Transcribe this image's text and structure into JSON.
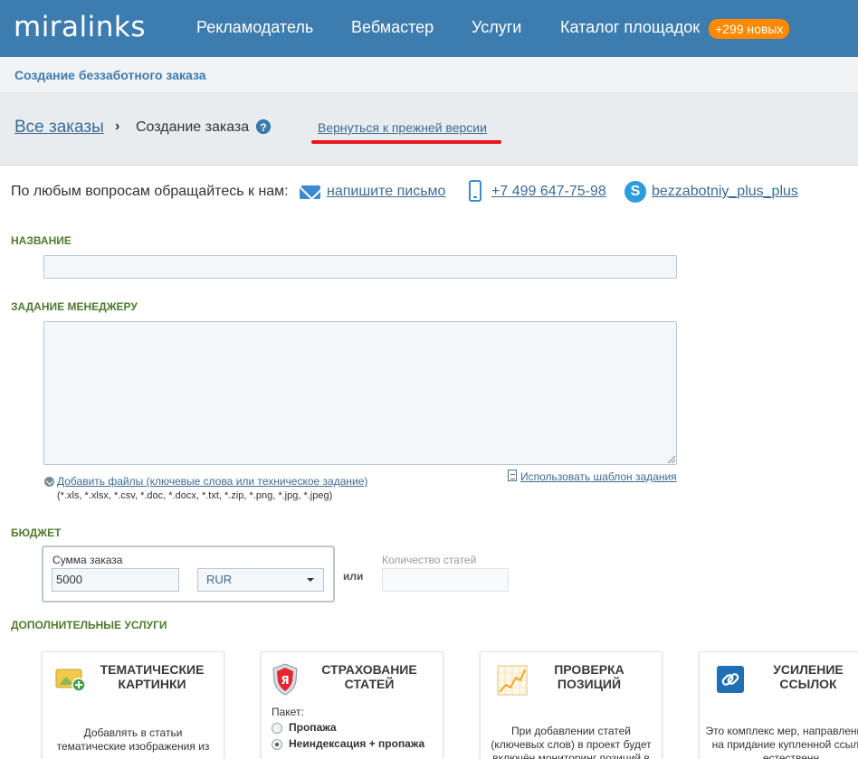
{
  "header": {
    "logo": "miralinks",
    "nav": [
      "Рекламодатель",
      "Вебмастер",
      "Услуги",
      "Каталог площадок"
    ],
    "badge": "+299 новых"
  },
  "subheader": {
    "title": "Создание беззаботного заказа"
  },
  "breadcrumb": {
    "all_orders": "Все заказы",
    "separator": "›",
    "current": "Создание заказа",
    "help": "?",
    "back_link": "Вернуться к прежней версии"
  },
  "contacts": {
    "text": "По любым вопросам обращайтесь к нам:",
    "email_link": "напишите письмо",
    "phone": "+7 499 647-75-98",
    "skype": "bezzabotniy_plus_plus"
  },
  "form": {
    "name_label": "НАЗВАНИЕ",
    "task_label": "ЗАДАНИЕ МЕНЕДЖЕРУ",
    "attach_link": "Добавить файлы (ключевые слова или техническое задание)",
    "attach_hint": "(*.xls, *.xlsx, *.csv, *.doc, *.docx, *.txt, *.zip, *.png, *.jpg, *.jpeg)",
    "template_link": "Использовать шаблон задания",
    "budget_label": "БЮДЖЕТ",
    "sum_label": "Сумма заказа",
    "sum_value": "5000",
    "currency": "RUR",
    "or": "или",
    "count_label": "Количество статей",
    "extra_label": "ДОПОЛНИТЕЛЬНЫЕ УСЛУГИ"
  },
  "services": [
    {
      "title": "ТЕМАТИЧЕСКИЕ КАРТИНКИ",
      "desc": "Добавлять в статьи тематические изображения из",
      "icon": "image-plus-icon"
    },
    {
      "title": "СТРАХОВАНИЕ СТАТЕЙ",
      "package_label": "Пакет:",
      "options": [
        "Пропажа",
        "Неиндексация + пропажа"
      ],
      "selected": 1,
      "icon": "shield-yandex-icon"
    },
    {
      "title": "ПРОВЕРКА ПОЗИЦИЙ",
      "desc": "При добавлении статей (ключевых слов) в проект будет включён мониторинг позиций в",
      "icon": "chart-icon"
    },
    {
      "title": "УСИЛЕНИЕ ССЫЛОК",
      "desc": "Это комплекс мер, направленный на придание купленной ссылке естественн",
      "icon": "link-icon"
    }
  ],
  "colors": {
    "brand": "#3d7cae",
    "badge": "#ff8a00",
    "section_label": "#4e7a2e",
    "link": "#3d6b93",
    "annotation_red": "#e8141b"
  }
}
